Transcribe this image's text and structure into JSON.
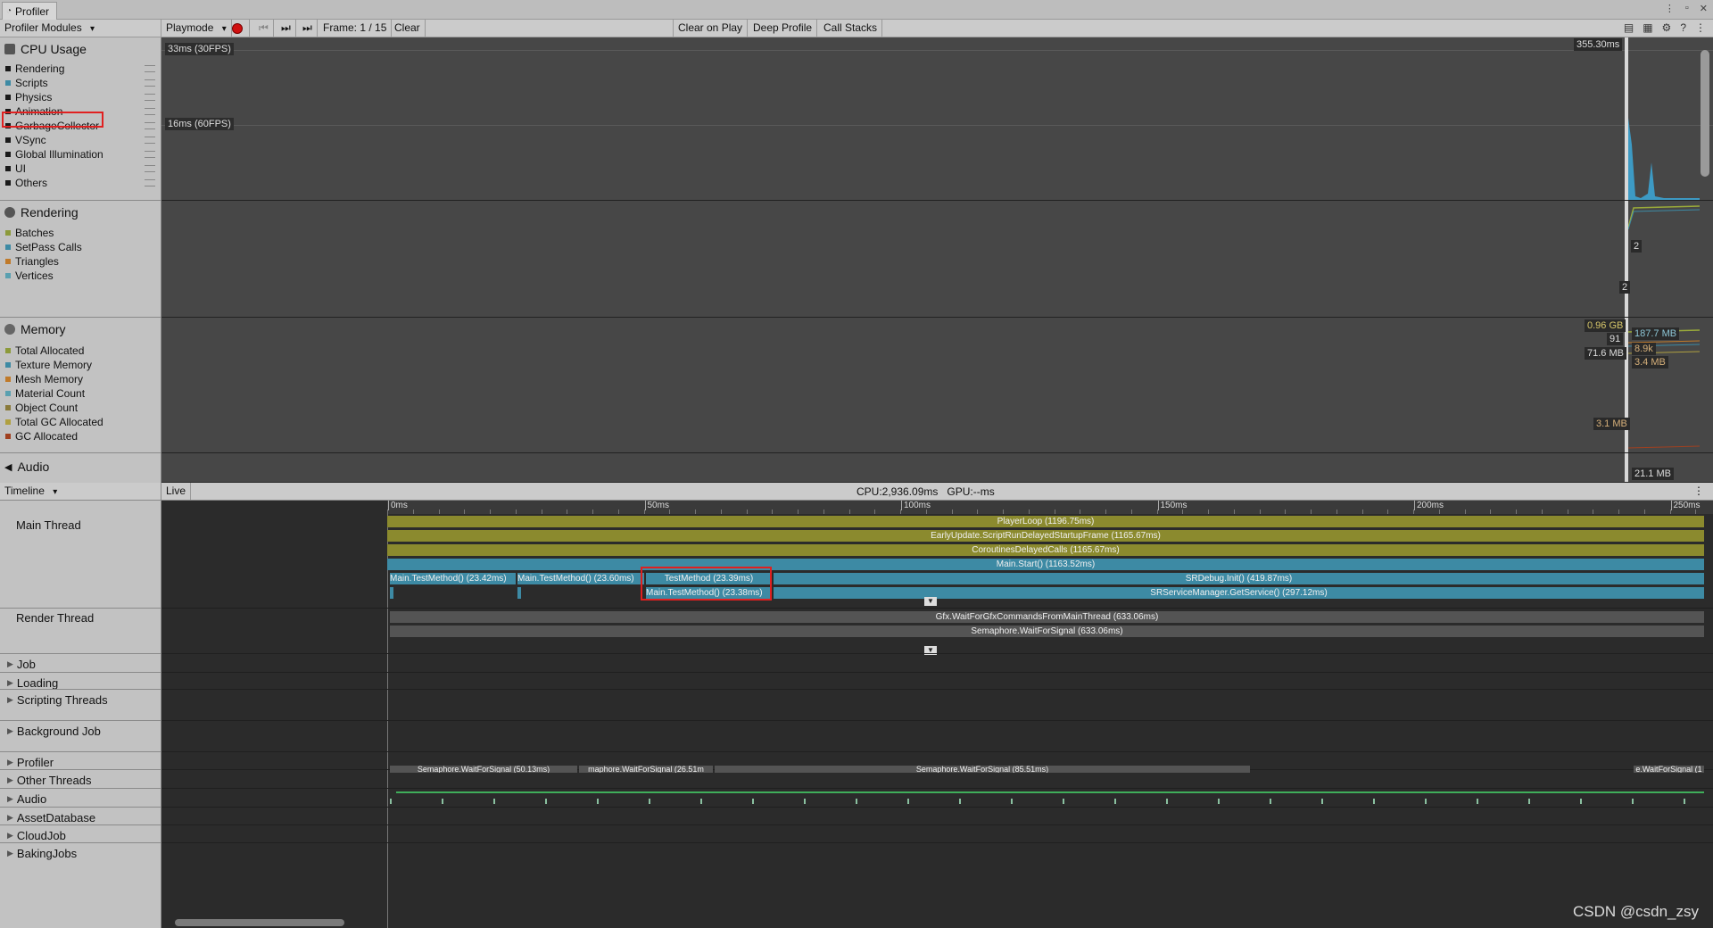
{
  "window": {
    "title": "Profiler"
  },
  "toolbar": {
    "modules_dropdown": "Profiler Modules",
    "playmode": "Playmode",
    "frame": "Frame: 1 / 15",
    "clear": "Clear",
    "clear_on_play": "Clear on Play",
    "deep_profile": "Deep Profile",
    "call_stacks": "Call Stacks"
  },
  "modules": {
    "cpu": {
      "title": "CPU Usage",
      "items": [
        {
          "label": "Rendering",
          "color": "#1a1a1a"
        },
        {
          "label": "Scripts",
          "color": "#3d8aa4"
        },
        {
          "label": "Physics",
          "color": "#1a1a1a"
        },
        {
          "label": "Animation",
          "color": "#1a1a1a"
        },
        {
          "label": "GarbageCollector",
          "color": "#1a1a1a"
        },
        {
          "label": "VSync",
          "color": "#1a1a1a"
        },
        {
          "label": "Global Illumination",
          "color": "#1a1a1a"
        },
        {
          "label": "UI",
          "color": "#1a1a1a"
        },
        {
          "label": "Others",
          "color": "#1a1a1a"
        }
      ]
    },
    "rendering": {
      "title": "Rendering",
      "items": [
        {
          "label": "Batches",
          "color": "#8c9a3a"
        },
        {
          "label": "SetPass Calls",
          "color": "#3d8aa4"
        },
        {
          "label": "Triangles",
          "color": "#c07a2a"
        },
        {
          "label": "Vertices",
          "color": "#5aa0b0"
        }
      ]
    },
    "memory": {
      "title": "Memory",
      "items": [
        {
          "label": "Total Allocated",
          "color": "#8c9a3a"
        },
        {
          "label": "Texture Memory",
          "color": "#3d8aa4"
        },
        {
          "label": "Mesh Memory",
          "color": "#c07a2a"
        },
        {
          "label": "Material Count",
          "color": "#5aa0b0"
        },
        {
          "label": "Object Count",
          "color": "#8a7a3a"
        },
        {
          "label": "Total GC Allocated",
          "color": "#b0a040"
        },
        {
          "label": "GC Allocated",
          "color": "#a04020"
        }
      ]
    },
    "audio": {
      "title": "Audio"
    }
  },
  "charts": {
    "fps30": "33ms (30FPS)",
    "fps60": "16ms (60FPS)",
    "cpu_peak": "355.30ms",
    "rendering_labels": [
      "2",
      "2"
    ],
    "memory_labels": [
      "0.96 GB",
      "187.7 MB",
      "91",
      "8.9k",
      "71.6 MB",
      "3.4 MB",
      "3.1 MB",
      "21.1 MB"
    ]
  },
  "timeline": {
    "view_dropdown": "Timeline",
    "live": "Live",
    "stats": "CPU:2,936.09ms   GPU:--ms",
    "ruler": [
      "0ms",
      "50ms",
      "100ms",
      "150ms",
      "200ms",
      "250ms"
    ],
    "threads": [
      "Main Thread",
      "Render Thread"
    ],
    "groups": [
      "Job",
      "Loading",
      "Scripting Threads",
      "Background Job",
      "Profiler",
      "Other Threads",
      "Audio",
      "AssetDatabase",
      "CloudJob",
      "BakingJobs"
    ],
    "main_bars": {
      "playerloop": "PlayerLoop (1196.75ms)",
      "earlyupdate": "EarlyUpdate.ScriptRunDelayedStartupFrame (1165.67ms)",
      "coroutines": "CoroutinesDelayedCalls (1165.67ms)",
      "mainstart": "Main.Start() (1163.52ms)",
      "tm1": "Main.TestMethod() (23.42ms)",
      "tm2": "Main.TestMethod() (23.60ms)",
      "testmethod": "TestMethod (23.39ms)",
      "tm3": "Main.TestMethod() (23.38ms)",
      "srdebug": "SRDebug.Init() (419.87ms)",
      "srservice": "SRServiceManager.GetService() (297.12ms)"
    },
    "render_bars": {
      "gfx": "Gfx.WaitForGfxCommandsFromMainThread (633.06ms)",
      "semaphore": "Semaphore.WaitForSignal (633.06ms)"
    },
    "profiler_bars": [
      "Semaphore.WaitForSignal (50.13ms)",
      "maphore.WaitForSignal (26.51m",
      "Semaphore.WaitForSignal (85.51ms)",
      "e.WaitForSignal (1"
    ]
  },
  "watermark": "CSDN @csdn_zsy"
}
